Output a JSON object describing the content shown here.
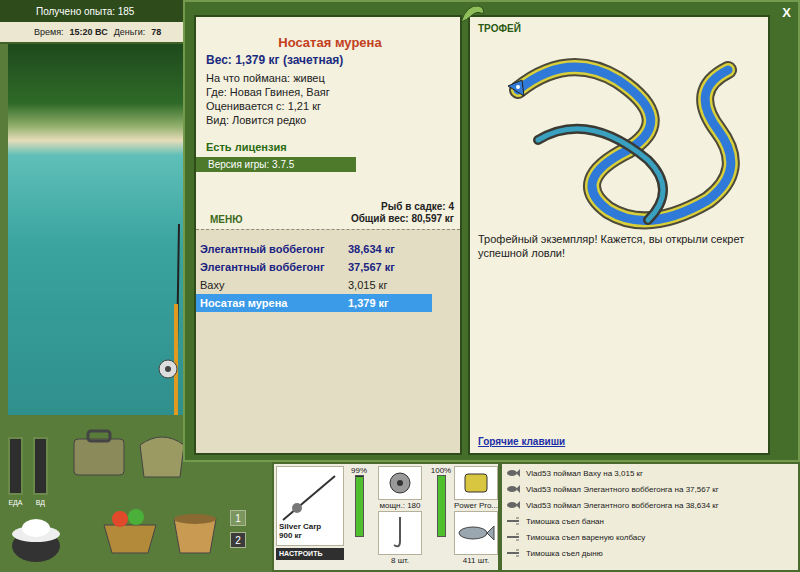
{
  "hud": {
    "experience": "Получено опыта: 185",
    "time_label": "Время:",
    "time": "15:20 ВС",
    "money_label": "Деньги:",
    "money": "78"
  },
  "gauges": [
    {
      "label": "ЕДА",
      "level": 0
    },
    {
      "label": "ВД",
      "level": 0
    }
  ],
  "pages": [
    {
      "label": "1",
      "selected": false
    },
    {
      "label": "2",
      "selected": true
    }
  ],
  "tackle": {
    "rod_name": "Silver Carp",
    "rod_load": "900 кг",
    "rod_condition": "99%",
    "rod_level": 0.99,
    "setup_button": "НАСТРОИТЬ",
    "reel_power": "мощн.: 180",
    "reel_condition": "100%",
    "reel_level": 1,
    "line": "Power Pro...",
    "hooks": "8 шт.",
    "bait": "411 шт."
  },
  "log": [
    {
      "text": "Vlad53 поймал Ваху на 3,015 кг",
      "kind": "catch"
    },
    {
      "text": "Vlad53 поймал Элегантного воббегонга на 37,567 кг",
      "kind": "catch"
    },
    {
      "text": "Vlad53 поймал Элегантного воббегонга на 38,634 кг",
      "kind": "catch"
    },
    {
      "text": "Тимошка съел банан",
      "kind": "eat"
    },
    {
      "text": "Тимошка съел вареную колбасу",
      "kind": "eat"
    },
    {
      "text": "Тимошка съел дыню",
      "kind": "eat"
    }
  ],
  "dialog": {
    "close": "X",
    "fish": {
      "name": "Носатая мурена",
      "weight": "Вес: 1,379 кг (зачетная)",
      "details": [
        "На что поймана: живец",
        "Где: Новая Гвинея, Ваяг",
        "Оценивается с: 1,21 кг",
        "Вид: Ловится редко"
      ],
      "license": "Есть лицензия",
      "version": "Версия игры: 3.7.5"
    },
    "menu": "МЕНЮ",
    "keepnet_count": "Рыб в садке: 4",
    "keepnet_weight": "Общий вес: 80,597 кг",
    "catch": [
      {
        "name": "Элегантный воббегонг",
        "weight": "38,634 кг",
        "counted": true,
        "selected": false
      },
      {
        "name": "Элегантный воббегонг",
        "weight": "37,567 кг",
        "counted": true,
        "selected": false
      },
      {
        "name": "Ваху",
        "weight": "3,015 кг",
        "counted": false,
        "selected": false
      },
      {
        "name": "Носатая мурена",
        "weight": "1,379 кг",
        "counted": true,
        "selected": true
      }
    ],
    "badge": "ТРОФЕЙ",
    "message": "Трофейный экземпляр! Кажется, вы открыли секрет успешной ловли!",
    "hotkeys": "Горячие клавиши"
  }
}
